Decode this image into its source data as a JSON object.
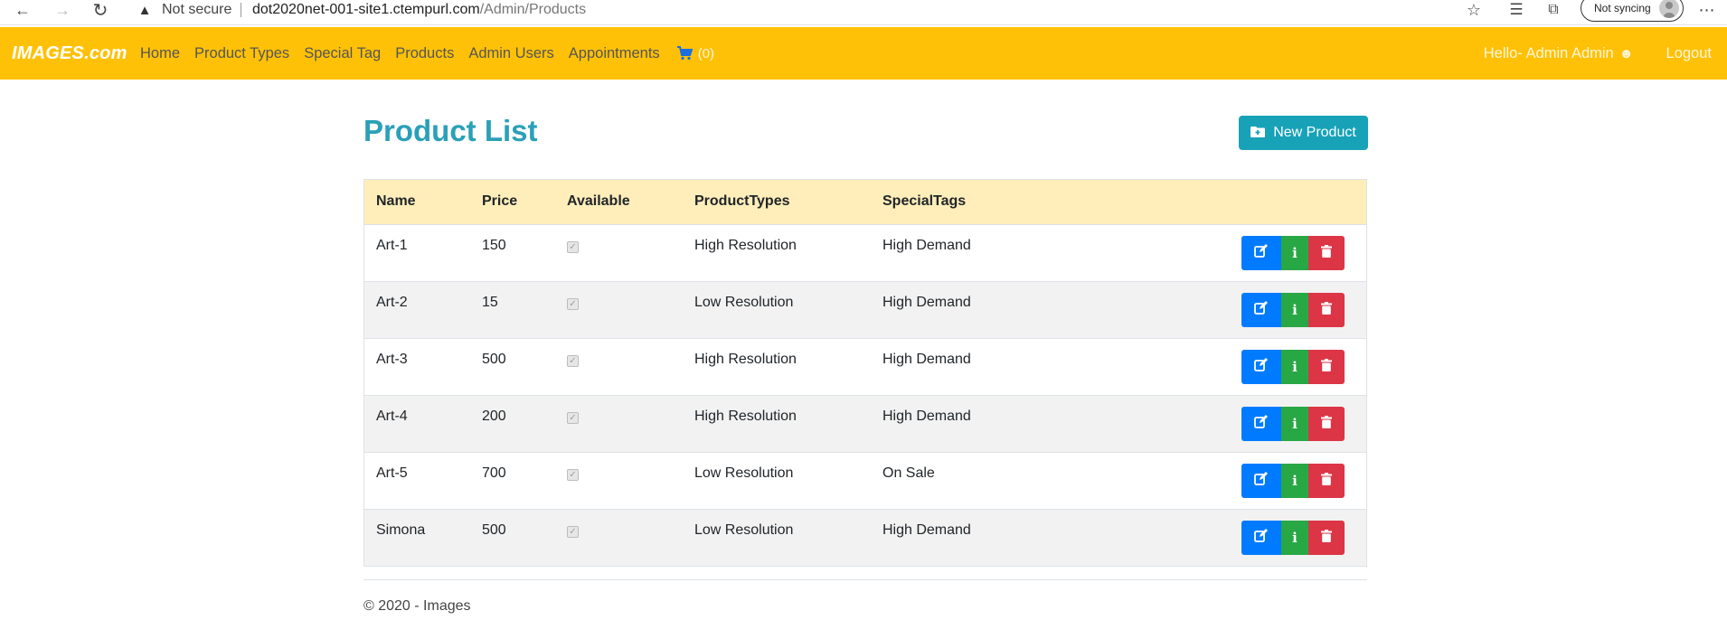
{
  "browser": {
    "security_label": "Not secure",
    "url_host": "dot2020net-001-site1.ctempurl.com",
    "url_path": "/Admin/Products",
    "sync_label": "Not syncing"
  },
  "navbar": {
    "brand": "IMAGES.com",
    "links": [
      "Home",
      "Product Types",
      "Special Tag",
      "Products",
      "Admin Users",
      "Appointments"
    ],
    "cart_count": "(0)",
    "greeting": "Hello- Admin Admin",
    "logout": "Logout",
    "bg_color": "#ffc107"
  },
  "main": {
    "title": "Product List",
    "new_button_label": "New Product",
    "columns": [
      "Name",
      "Price",
      "Available",
      "ProductTypes",
      "SpecialTags"
    ],
    "rows": [
      {
        "name": "Art-1",
        "price": "150",
        "available": true,
        "type": "High Resolution",
        "tag": "High Demand"
      },
      {
        "name": "Art-2",
        "price": "15",
        "available": true,
        "type": "Low Resolution",
        "tag": "High Demand"
      },
      {
        "name": "Art-3",
        "price": "500",
        "available": true,
        "type": "High Resolution",
        "tag": "High Demand"
      },
      {
        "name": "Art-4",
        "price": "200",
        "available": true,
        "type": "High Resolution",
        "tag": "High Demand"
      },
      {
        "name": "Art-5",
        "price": "700",
        "available": true,
        "type": "Low Resolution",
        "tag": "On Sale"
      },
      {
        "name": "Simona",
        "price": "500",
        "available": true,
        "type": "Low Resolution",
        "tag": "High Demand"
      }
    ],
    "row_actions": [
      "edit-icon",
      "info-icon",
      "trash-icon"
    ]
  },
  "footer": {
    "text": "© 2020 - Images"
  },
  "colors": {
    "title": "#2aa0b8",
    "header_row": "#ffeeba",
    "edit": "#007bff",
    "info": "#28a745",
    "delete": "#dc3545"
  }
}
